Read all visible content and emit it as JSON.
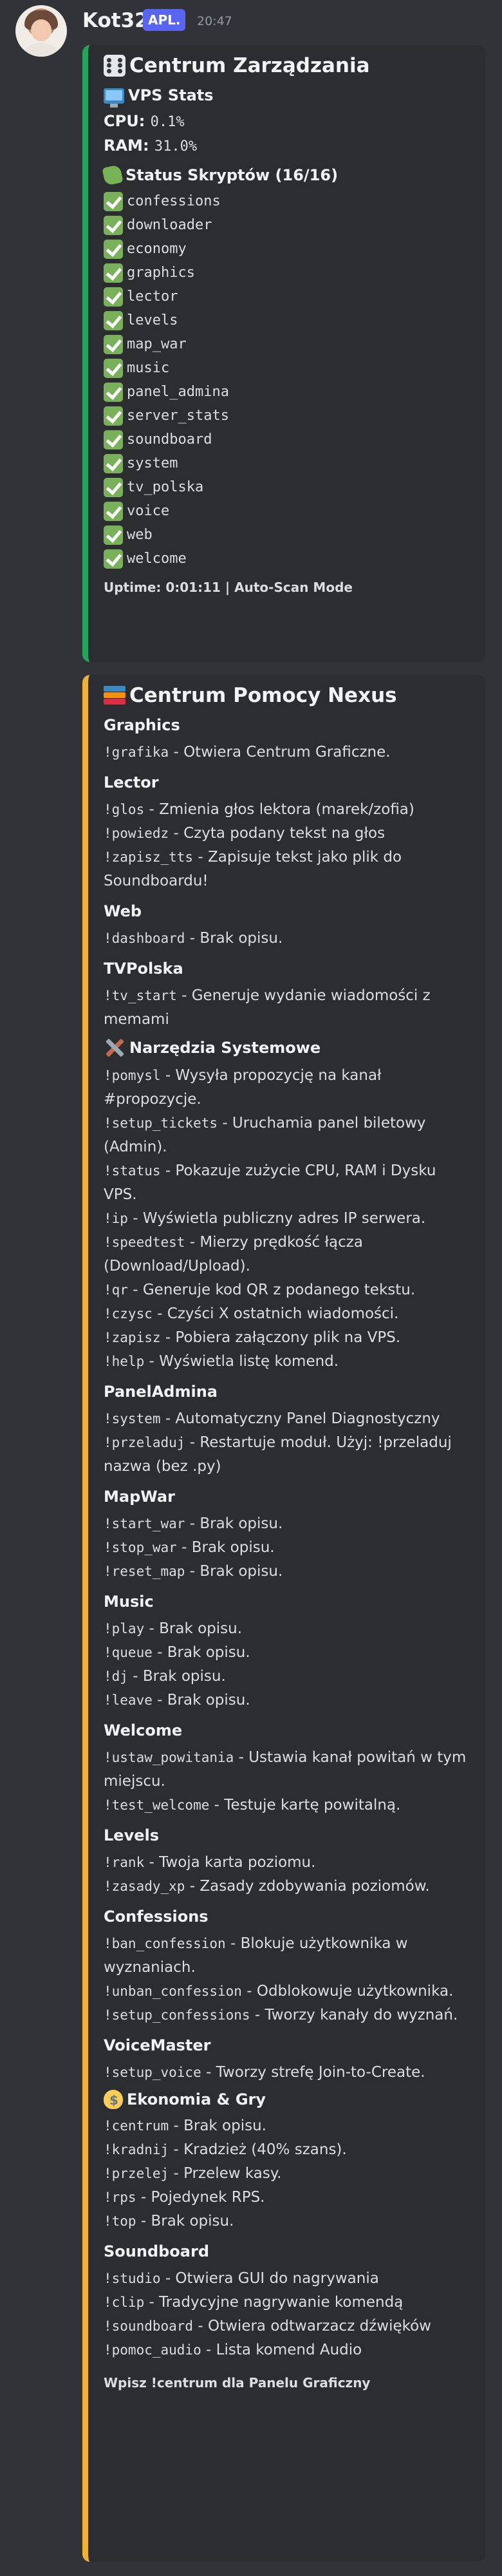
{
  "message": {
    "username": "Kot32",
    "badge": "APL.",
    "timestamp": "20:47"
  },
  "panel": {
    "title": "Centrum Zarządzania",
    "title_icon": "game-die-icon",
    "vps_header": "VPS Stats",
    "vps_icon": "desktop-computer-icon",
    "cpu_label": "CPU:",
    "cpu_value": "0.1%",
    "ram_label": "RAM:",
    "ram_value": "31.0%",
    "scripts_header": "Status Skryptów (16/16)",
    "scripts_icon": "puzzle-piece-icon",
    "scripts": [
      "confessions",
      "downloader",
      "economy",
      "graphics",
      "lector",
      "levels",
      "map_war",
      "music",
      "panel_admina",
      "server_stats",
      "soundboard",
      "system",
      "tv_polska",
      "voice",
      "web",
      "welcome"
    ],
    "footer": "Uptime: 0:01:11 | Auto-Scan Mode",
    "accent_color": "#23a55a"
  },
  "help": {
    "title": "Centrum Pomocy Nexus",
    "title_icon": "books-icon",
    "accent_color": "#f0b232",
    "sections": [
      {
        "title": "Graphics",
        "commands": [
          {
            "cmd": "!grafika",
            "desc": " - Otwiera Centrum Graficzne."
          }
        ]
      },
      {
        "title": "Lector",
        "commands": [
          {
            "cmd": "!glos",
            "desc": " - Zmienia głos lektora (marek/zofia)"
          },
          {
            "cmd": "!powiedz",
            "desc": " - Czyta podany tekst na głos"
          },
          {
            "cmd": "!zapisz_tts",
            "desc": " - Zapisuje tekst jako plik do Soundboardu!"
          }
        ]
      },
      {
        "title": "Web",
        "commands": [
          {
            "cmd": "!dashboard",
            "desc": " - Brak opisu."
          }
        ]
      },
      {
        "title": "TVPolska",
        "commands": [
          {
            "cmd": "!tv_start",
            "desc": " - Generuje wydanie wiadomości z memami"
          }
        ]
      },
      {
        "title": "Narzędzia Systemowe",
        "icon": "hammer-and-wrench-icon",
        "commands": [
          {
            "cmd": "!pomysl",
            "desc": " - Wysyła propozycję na kanał #propozycje."
          },
          {
            "cmd": "!setup_tickets",
            "desc": " - Uruchamia panel biletowy (Admin)."
          },
          {
            "cmd": "!status",
            "desc": " - Pokazuje zużycie CPU, RAM i Dysku VPS."
          },
          {
            "cmd": "!ip",
            "desc": " - Wyświetla publiczny adres IP serwera."
          },
          {
            "cmd": "!speedtest",
            "desc": " - Mierzy prędkość łącza (Download/Upload)."
          },
          {
            "cmd": "!qr",
            "desc": " - Generuje kod QR z podanego tekstu."
          },
          {
            "cmd": "!czysc",
            "desc": " - Czyści X ostatnich wiadomości."
          },
          {
            "cmd": "!zapisz",
            "desc": " - Pobiera załączony plik na VPS."
          },
          {
            "cmd": "!help",
            "desc": " - Wyświetla listę komend."
          }
        ]
      },
      {
        "title": "PanelAdmina",
        "commands": [
          {
            "cmd": "!system",
            "desc": " - Automatyczny Panel Diagnostyczny"
          },
          {
            "cmd": "!przeladuj",
            "desc": " - Restartuje moduł. Użyj: !przeladuj nazwa (bez .py)"
          }
        ]
      },
      {
        "title": "MapWar",
        "commands": [
          {
            "cmd": "!start_war",
            "desc": " - Brak opisu."
          },
          {
            "cmd": "!stop_war",
            "desc": " - Brak opisu."
          },
          {
            "cmd": "!reset_map",
            "desc": " - Brak opisu."
          }
        ]
      },
      {
        "title": "Music",
        "commands": [
          {
            "cmd": "!play",
            "desc": " - Brak opisu."
          },
          {
            "cmd": "!queue",
            "desc": " - Brak opisu."
          },
          {
            "cmd": "!dj",
            "desc": " - Brak opisu."
          },
          {
            "cmd": "!leave",
            "desc": " - Brak opisu."
          }
        ]
      },
      {
        "title": "Welcome",
        "commands": [
          {
            "cmd": "!ustaw_powitania",
            "desc": " - Ustawia kanał powitań w tym miejscu."
          },
          {
            "cmd": "!test_welcome",
            "desc": " - Testuje kartę powitalną."
          }
        ]
      },
      {
        "title": "Levels",
        "commands": [
          {
            "cmd": "!rank",
            "desc": " - Twoja karta poziomu."
          },
          {
            "cmd": "!zasady_xp",
            "desc": " - Zasady zdobywania poziomów."
          }
        ]
      },
      {
        "title": "Confessions",
        "commands": [
          {
            "cmd": "!ban_confession",
            "desc": " - Blokuje użytkownika w wyznaniach."
          },
          {
            "cmd": "!unban_confession",
            "desc": " - Odblokowuje użytkownika."
          },
          {
            "cmd": "!setup_confessions",
            "desc": " - Tworzy kanały do wyznań."
          }
        ]
      },
      {
        "title": "VoiceMaster",
        "commands": [
          {
            "cmd": "!setup_voice",
            "desc": " - Tworzy strefę Join-to-Create."
          }
        ]
      },
      {
        "title": "Ekonomia & Gry",
        "icon": "money-bag-icon",
        "commands": [
          {
            "cmd": "!centrum",
            "desc": " - Brak opisu."
          },
          {
            "cmd": "!kradnij",
            "desc": " - Kradzież (40% szans)."
          },
          {
            "cmd": "!przelej",
            "desc": " - Przelew kasy."
          },
          {
            "cmd": "!rps",
            "desc": " - Pojedynek RPS."
          },
          {
            "cmd": "!top",
            "desc": " - Brak opisu."
          }
        ]
      },
      {
        "title": "Soundboard",
        "commands": [
          {
            "cmd": "!studio",
            "desc": " - Otwiera GUI do nagrywania"
          },
          {
            "cmd": "!clip",
            "desc": " - Tradycyjne nagrywanie komendą"
          },
          {
            "cmd": "!soundboard",
            "desc": " - Otwiera odtwarzacz dźwięków"
          },
          {
            "cmd": "!pomoc_audio",
            "desc": " - Lista komend Audio"
          }
        ]
      }
    ],
    "footer": "Wpisz !centrum dla Panelu Graficzny"
  }
}
